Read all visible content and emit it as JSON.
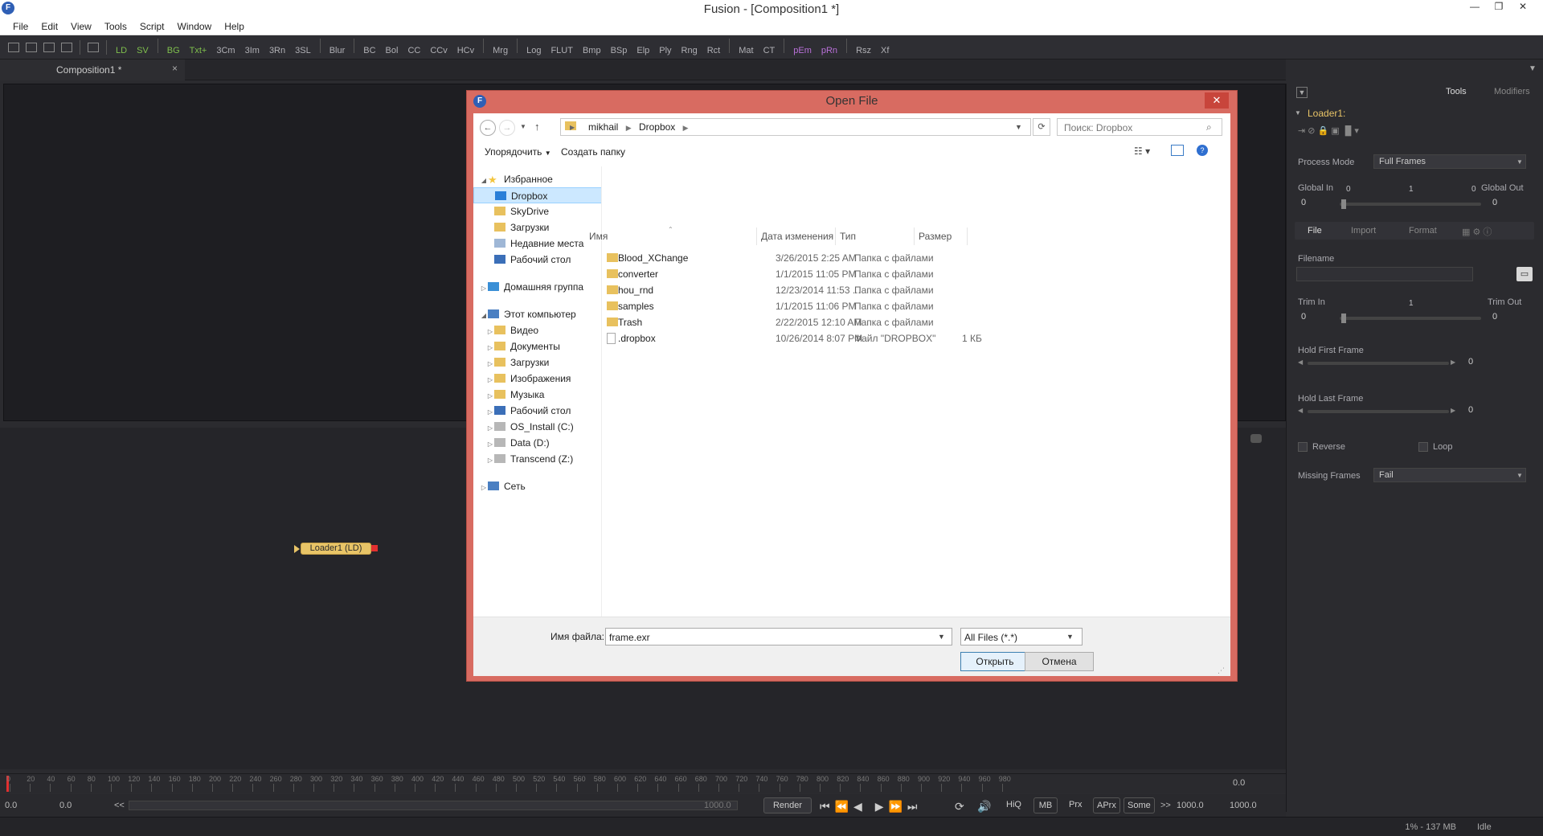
{
  "window": {
    "title": "Fusion - [Composition1 *]",
    "app_icon": "fusion-icon"
  },
  "menu": [
    "File",
    "Edit",
    "View",
    "Tools",
    "Script",
    "Window",
    "Help"
  ],
  "toolbar": [
    "LD",
    "SV",
    "BG",
    "Txt+",
    "3Cm",
    "3Im",
    "3Rn",
    "3SL",
    "Blur",
    "BC",
    "Bol",
    "CC",
    "CCv",
    "HCv",
    "Mrg",
    "Log",
    "FLUT",
    "Bmp",
    "BSp",
    "Elp",
    "Ply",
    "Rng",
    "Rct",
    "Mat",
    "CT",
    "pEm",
    "pRn",
    "Rsz",
    "Xf"
  ],
  "tab": {
    "label": "Composition1 *",
    "close": "×"
  },
  "flow": {
    "node_label": "Loader1  (LD)"
  },
  "inspector": {
    "tabs": [
      "Tools",
      "Modifiers"
    ],
    "tool_name": "Loader1:",
    "process_mode_label": "Process Mode",
    "process_mode_value": "Full Frames",
    "global_in_label": "Global In",
    "global_out_label": "Global Out",
    "global_range": [
      "0",
      "1",
      "0"
    ],
    "global_in_value": "0",
    "global_out_value": "0",
    "subtabs": [
      "File",
      "Import",
      "Format"
    ],
    "filename_label": "Filename",
    "trim_in_label": "Trim In",
    "trim_out_label": "Trim Out",
    "trim_mid": "1",
    "trim_in_value": "0",
    "trim_out_value": "0",
    "hold_first_label": "Hold First Frame",
    "hold_first_value": "0",
    "hold_last_label": "Hold Last Frame",
    "hold_last_value": "0",
    "reverse_label": "Reverse",
    "loop_label": "Loop",
    "missing_frames_label": "Missing Frames",
    "missing_frames_value": "Fail"
  },
  "timeline": {
    "ticks": [
      "0",
      "20",
      "40",
      "60",
      "80",
      "100",
      "120",
      "140",
      "160",
      "180",
      "200",
      "220",
      "240",
      "260",
      "280",
      "300",
      "320",
      "340",
      "360",
      "380",
      "400",
      "420",
      "440",
      "460",
      "480",
      "500",
      "520",
      "540",
      "560",
      "580",
      "600",
      "620",
      "640",
      "660",
      "680",
      "700",
      "720",
      "740",
      "760",
      "780",
      "800",
      "820",
      "840",
      "860",
      "880",
      "900",
      "920",
      "940",
      "960",
      "980"
    ],
    "current": "0.0",
    "start": "0.0",
    "render_start": "0.0",
    "render_end_display": "1000.0",
    "end": "1000.0",
    "end2": "1000.0",
    "prev_chevron": "<<",
    "next_chevron": ">>"
  },
  "playback": {
    "render_label": "Render",
    "buttons": [
      "HiQ",
      "MB",
      "Prx",
      "APrx",
      "Some"
    ]
  },
  "status": {
    "memory": "1% - 137 MB",
    "state": "Idle"
  },
  "dialog": {
    "title": "Open File",
    "address": [
      "mikhail",
      "Dropbox"
    ],
    "search_placeholder": "Поиск: Dropbox",
    "organize_label": "Упорядочить",
    "new_folder_label": "Создать папку",
    "nav": [
      {
        "label": "Избранное",
        "level": 0,
        "expander": "◢",
        "icon": "star-icon"
      },
      {
        "label": "Dropbox",
        "level": 1,
        "selected": true,
        "icon": "dropbox-icon"
      },
      {
        "label": "SkyDrive",
        "level": 1,
        "icon": "folder-icon"
      },
      {
        "label": "Загрузки",
        "level": 1,
        "icon": "folder-icon"
      },
      {
        "label": "Недавние места",
        "level": 1,
        "icon": "recent-icon"
      },
      {
        "label": "Рабочий стол",
        "level": 1,
        "icon": "desktop-icon"
      },
      {
        "label": "",
        "level": 0,
        "spacer": true
      },
      {
        "label": "Домашняя группа",
        "level": 0,
        "expander": "▷",
        "icon": "homegroup-icon"
      },
      {
        "label": "",
        "level": 0,
        "spacer": true
      },
      {
        "label": "Этот компьютер",
        "level": 0,
        "expander": "◢",
        "icon": "computer-icon"
      },
      {
        "label": "Видео",
        "level": 1,
        "expander": "▷",
        "icon": "folder-icon"
      },
      {
        "label": "Документы",
        "level": 1,
        "expander": "▷",
        "icon": "folder-icon"
      },
      {
        "label": "Загрузки",
        "level": 1,
        "expander": "▷",
        "icon": "folder-icon"
      },
      {
        "label": "Изображения",
        "level": 1,
        "expander": "▷",
        "icon": "folder-icon"
      },
      {
        "label": "Музыка",
        "level": 1,
        "expander": "▷",
        "icon": "folder-icon"
      },
      {
        "label": "Рабочий стол",
        "level": 1,
        "expander": "▷",
        "icon": "desktop-icon"
      },
      {
        "label": "OS_Install (C:)",
        "level": 1,
        "expander": "▷",
        "icon": "drive-icon"
      },
      {
        "label": "Data (D:)",
        "level": 1,
        "expander": "▷",
        "icon": "drive-icon"
      },
      {
        "label": "Transcend (Z:)",
        "level": 1,
        "expander": "▷",
        "icon": "drive-icon"
      },
      {
        "label": "",
        "level": 0,
        "spacer": true
      },
      {
        "label": "Сеть",
        "level": 0,
        "expander": "▷",
        "icon": "network-icon"
      }
    ],
    "columns": [
      "Имя",
      "Дата изменения",
      "Тип",
      "Размер"
    ],
    "files": [
      {
        "name": "Blood_XChange",
        "date": "3/26/2015 2:25 AM",
        "type": "Папка с файлами",
        "size": "",
        "icon": "folder-icon"
      },
      {
        "name": "converter",
        "date": "1/1/2015 11:05 PM",
        "type": "Папка с файлами",
        "size": "",
        "icon": "folder-icon"
      },
      {
        "name": "hou_rnd",
        "date": "12/23/2014 11:53 ...",
        "type": "Папка с файлами",
        "size": "",
        "icon": "folder-icon"
      },
      {
        "name": "samples",
        "date": "1/1/2015 11:06 PM",
        "type": "Папка с файлами",
        "size": "",
        "icon": "folder-icon"
      },
      {
        "name": "Trash",
        "date": "2/22/2015 12:10 AM",
        "type": "Папка с файлами",
        "size": "",
        "icon": "folder-icon"
      },
      {
        "name": ".dropbox",
        "date": "10/26/2014 8:07 PM",
        "type": "Файл \"DROPBOX\"",
        "size": "1 КБ",
        "icon": "file-icon"
      }
    ],
    "filename_label": "Имя файла:",
    "filename_value": "frame.exr",
    "filter_value": "All Files (*.*)",
    "open_label": "Открыть",
    "cancel_label": "Отмена"
  },
  "colors": {
    "accent_green": "#7fbf4d",
    "accent_purple": "#b970d8",
    "node": "#e8c467",
    "dialog_frame": "#d86b61"
  }
}
